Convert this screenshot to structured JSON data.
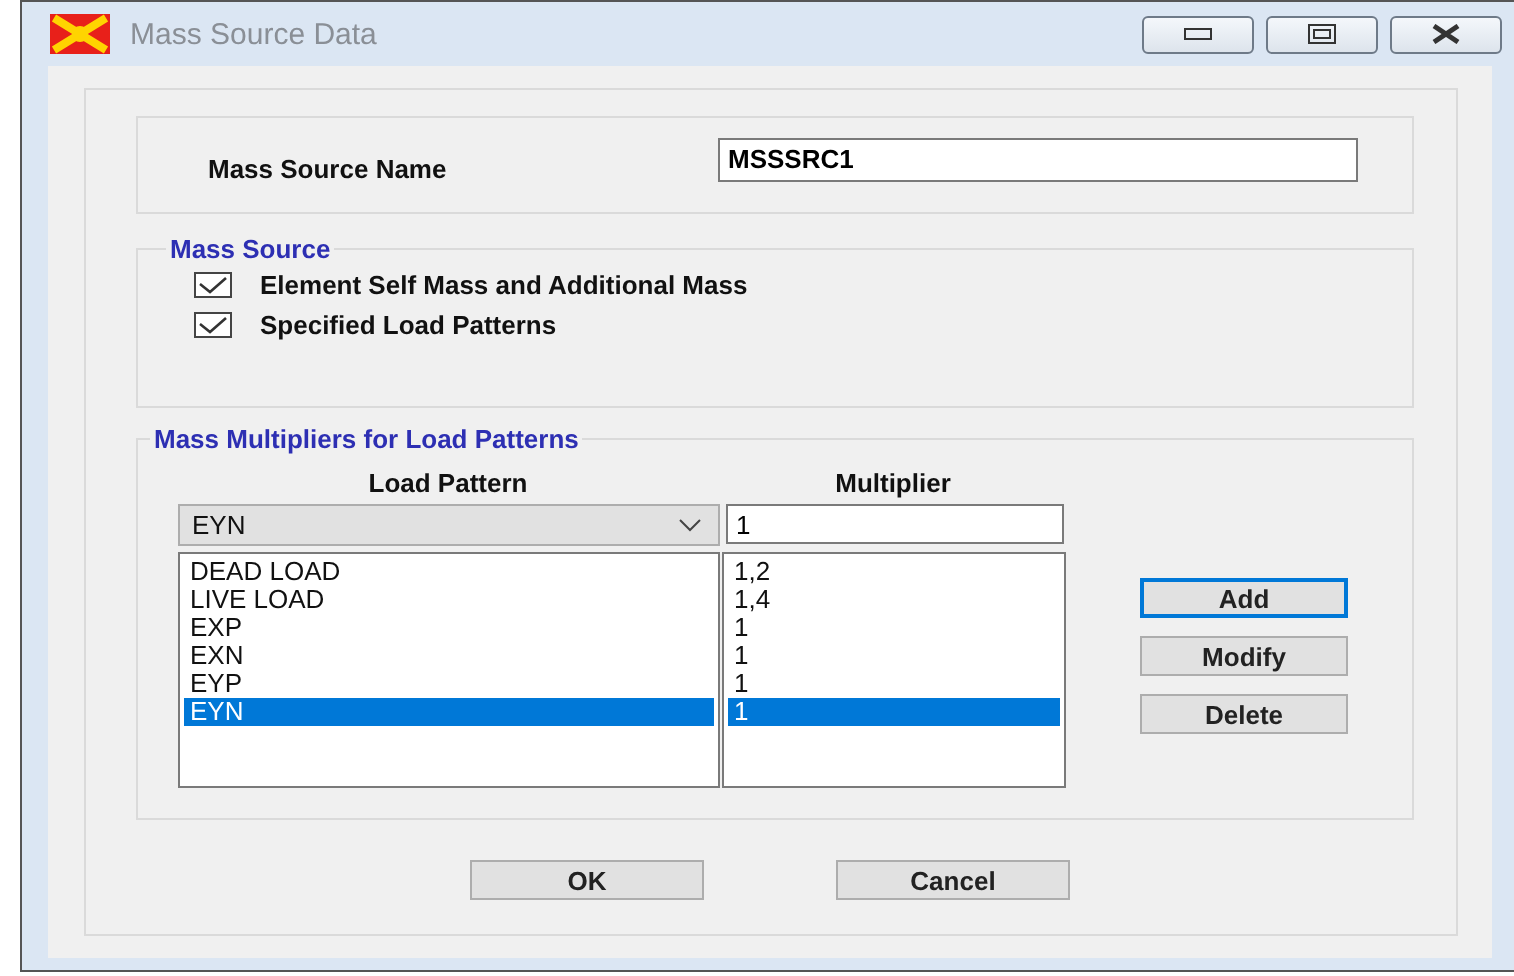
{
  "window": {
    "title": "Mass Source Data"
  },
  "name_field": {
    "label": "Mass Source Name",
    "value": "MSSSRC1"
  },
  "mass_source": {
    "title": "Mass Source",
    "options": [
      {
        "label": "Element Self Mass and Additional Mass",
        "checked": true
      },
      {
        "label": "Specified Load Patterns",
        "checked": true
      }
    ]
  },
  "multipliers": {
    "title": "Mass Multipliers for Load Patterns",
    "columns": [
      "Load Pattern",
      "Multiplier"
    ],
    "combo": {
      "value": "EYN"
    },
    "multiplier_input": {
      "value": "1"
    },
    "rows": [
      {
        "load_pattern": "DEAD LOAD",
        "multiplier": "1,2",
        "selected": false
      },
      {
        "load_pattern": "LIVE LOAD",
        "multiplier": "1,4",
        "selected": false
      },
      {
        "load_pattern": "EXP",
        "multiplier": "1",
        "selected": false
      },
      {
        "load_pattern": "EXN",
        "multiplier": "1",
        "selected": false
      },
      {
        "load_pattern": "EYP",
        "multiplier": "1",
        "selected": false
      },
      {
        "load_pattern": "EYN",
        "multiplier": "1",
        "selected": true
      }
    ],
    "buttons": [
      {
        "label": "Add",
        "focused": true
      },
      {
        "label": "Modify",
        "focused": false
      },
      {
        "label": "Delete",
        "focused": false
      }
    ]
  },
  "footer_buttons": [
    "OK",
    "Cancel"
  ]
}
